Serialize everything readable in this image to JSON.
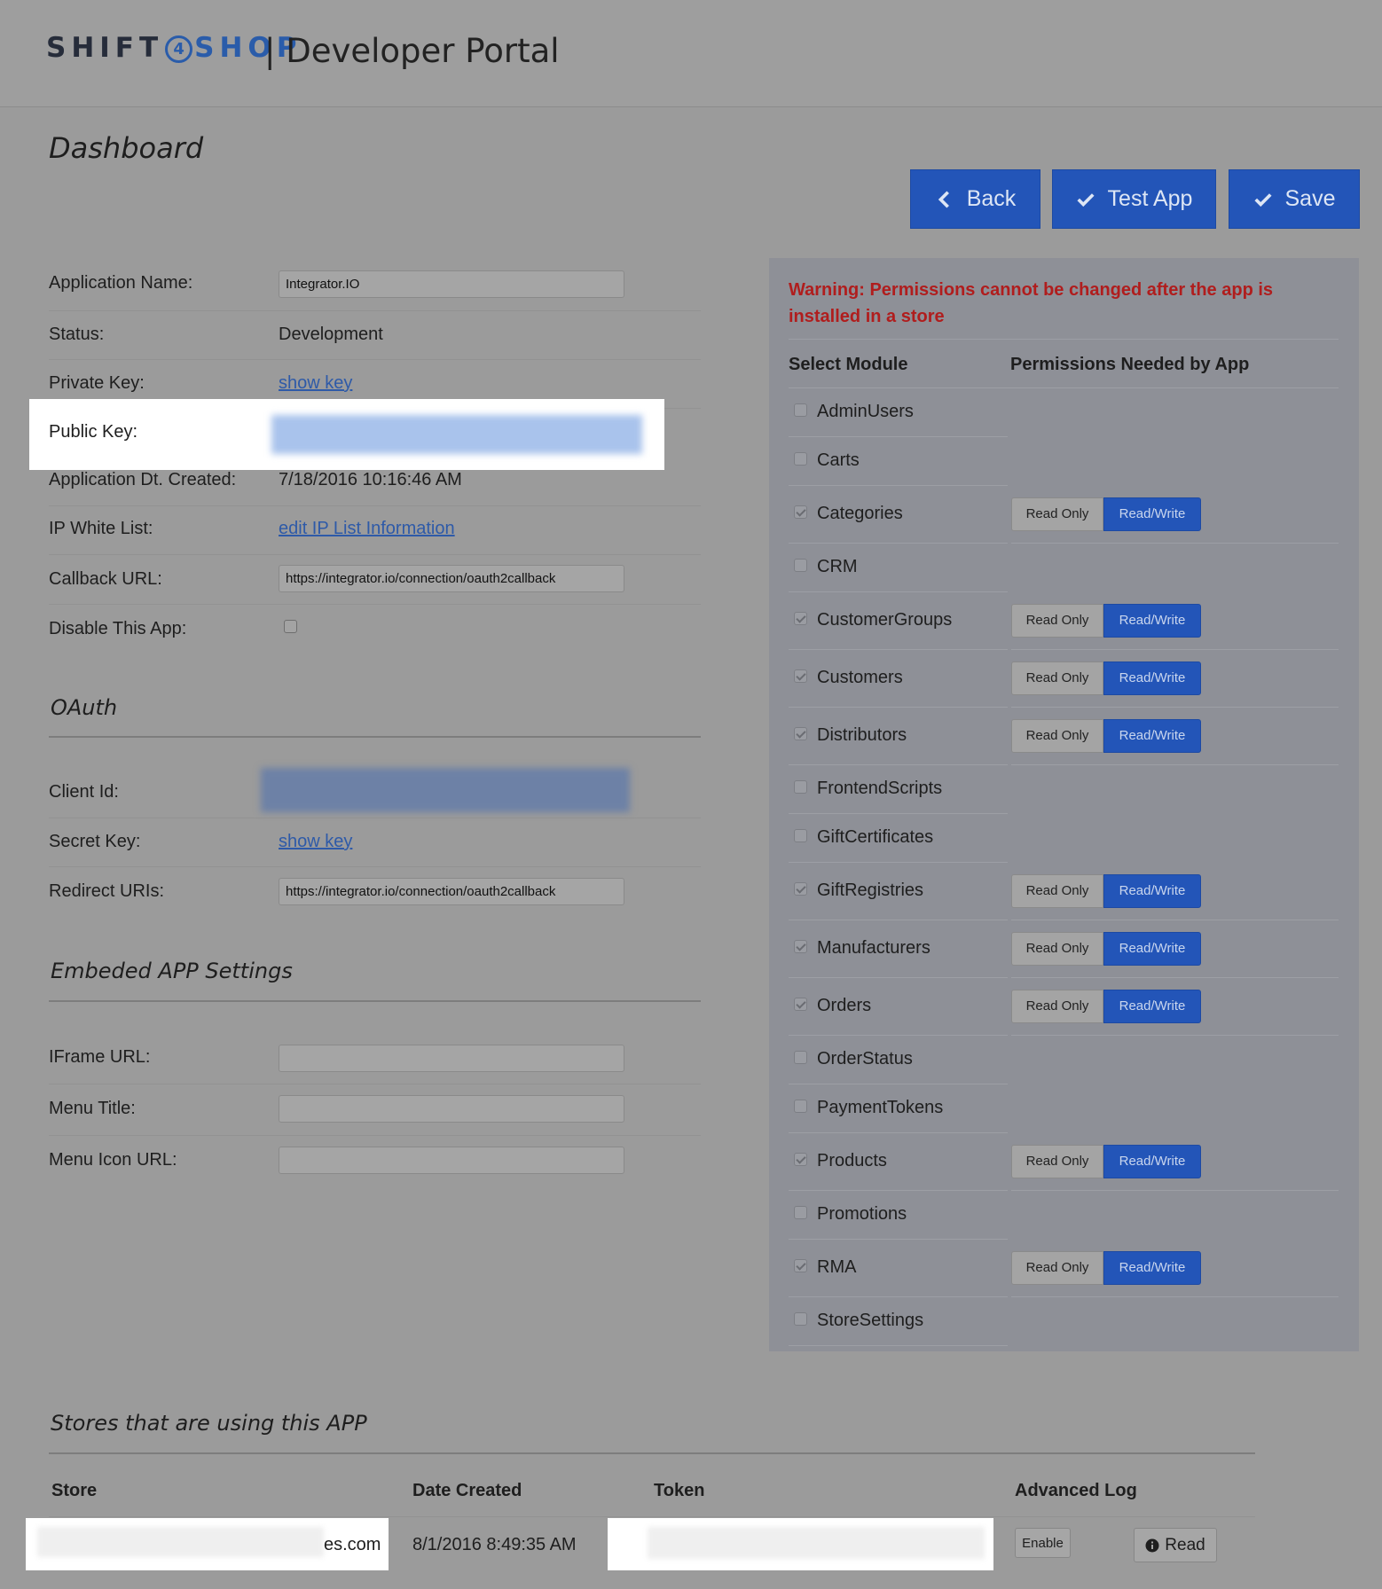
{
  "header": {
    "logo_shift": "SHIFT",
    "logo_four": "4",
    "logo_shop": "SHOP",
    "portal_title": "| Developer Portal"
  },
  "page_title": "Dashboard",
  "actions": {
    "back": "Back",
    "test_app": "Test App",
    "save": "Save"
  },
  "form": {
    "application_name_label": "Application Name:",
    "application_name_value": "Integrator.IO",
    "status_label": "Status:",
    "status_value": "Development",
    "private_key_label": "Private Key:",
    "private_key_link": "show key",
    "public_key_label": "Public Key:",
    "date_created_label": "Application Dt. Created:",
    "date_created_value": "7/18/2016 10:16:46 AM",
    "ip_white_list_label": "IP White List:",
    "ip_white_list_link": "edit IP List Information",
    "callback_url_label": "Callback URL:",
    "callback_url_value": "https://integrator.io/connection/oauth2callback",
    "disable_app_label": "Disable This App:"
  },
  "oauth": {
    "title": "OAuth",
    "client_id_label": "Client Id:",
    "secret_key_label": "Secret Key:",
    "secret_key_link": "show key",
    "redirect_uris_label": "Redirect URIs:",
    "redirect_uris_value": "https://integrator.io/connection/oauth2callback"
  },
  "embedded": {
    "title": "Embeded APP Settings",
    "iframe_url_label": "IFrame URL:",
    "menu_title_label": "Menu Title:",
    "menu_icon_url_label": "Menu Icon URL:"
  },
  "permissions": {
    "warning": "Warning: Permissions cannot be changed after the app is installed in a store",
    "col_module": "Select Module",
    "col_permissions": "Permissions Needed by App",
    "read_only": "Read Only",
    "read_write": "Read/Write",
    "modules": [
      {
        "name": "AdminUsers",
        "checked": false
      },
      {
        "name": "Carts",
        "checked": false
      },
      {
        "name": "Categories",
        "checked": true
      },
      {
        "name": "CRM",
        "checked": false
      },
      {
        "name": "CustomerGroups",
        "checked": true
      },
      {
        "name": "Customers",
        "checked": true
      },
      {
        "name": "Distributors",
        "checked": true
      },
      {
        "name": "FrontendScripts",
        "checked": false
      },
      {
        "name": "GiftCertificates",
        "checked": false
      },
      {
        "name": "GiftRegistries",
        "checked": true
      },
      {
        "name": "Manufacturers",
        "checked": true
      },
      {
        "name": "Orders",
        "checked": true
      },
      {
        "name": "OrderStatus",
        "checked": false
      },
      {
        "name": "PaymentTokens",
        "checked": false
      },
      {
        "name": "Products",
        "checked": true
      },
      {
        "name": "Promotions",
        "checked": false
      },
      {
        "name": "RMA",
        "checked": true
      },
      {
        "name": "StoreSettings",
        "checked": false
      }
    ]
  },
  "stores": {
    "title": "Stores that are using this APP",
    "col_store": "Store",
    "col_date_created": "Date Created",
    "col_token": "Token",
    "col_advanced_log": "Advanced Log",
    "row": {
      "store_suffix": "es.com",
      "date_created": "8/1/2016 8:49:35 AM",
      "enable": "Enable",
      "read": "Read"
    }
  }
}
